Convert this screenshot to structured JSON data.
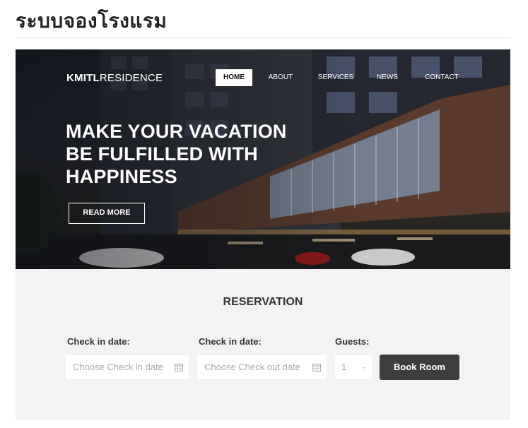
{
  "page": {
    "heading": "ระบบจองโรงแรม"
  },
  "hero": {
    "brand_bold": "KMITL",
    "brand_light": "RESIDENCE",
    "nav": [
      "HOME",
      "ABOUT",
      "SERVICES",
      "NEWS",
      "CONTACT"
    ],
    "active_nav": "HOME",
    "title_lines": [
      "MAKE YOUR VACATION",
      "BE FULFILLED WITH",
      "HAPPINESS"
    ],
    "read_more_label": "READ MORE"
  },
  "reservation": {
    "title": "RESERVATION",
    "check_in_label": "Check in date:",
    "check_in_placeholder": "Choose Check in date",
    "check_out_label": "Check in date:",
    "check_out_placeholder": "Choose Check out date",
    "guests_label": "Guests:",
    "guests_value": "1",
    "book_label": "Book Room"
  }
}
